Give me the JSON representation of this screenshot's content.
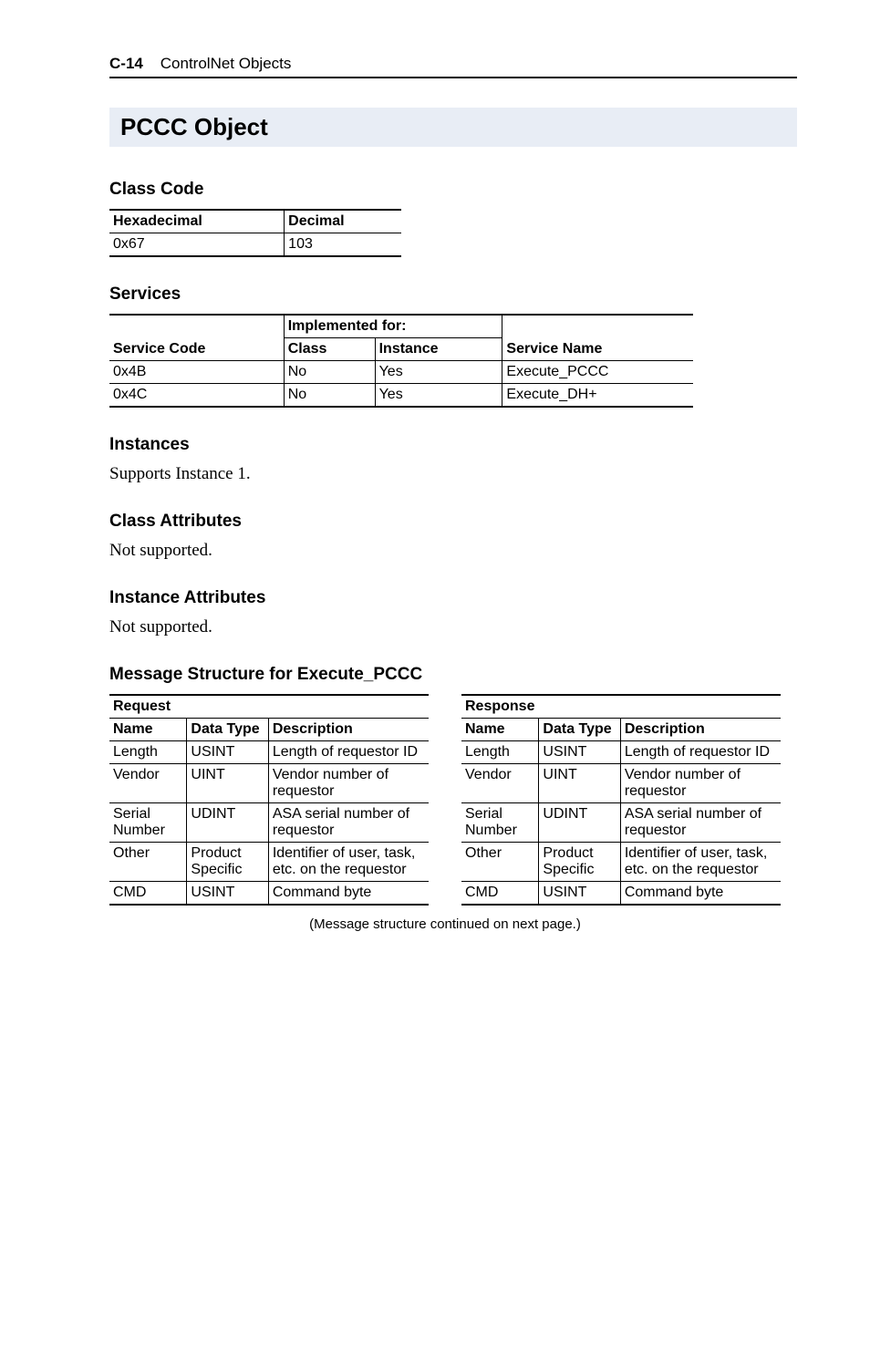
{
  "header": {
    "pagenum": "C-14",
    "chapter": "ControlNet Objects"
  },
  "title": "PCCC Object",
  "classcode": {
    "heading": "Class Code",
    "cols": {
      "hex": "Hexadecimal",
      "dec": "Decimal"
    },
    "row": {
      "hex": "0x67",
      "dec": "103"
    }
  },
  "services": {
    "heading": "Services",
    "implfor": "Implemented for:",
    "cols": {
      "code": "Service Code",
      "cls": "Class",
      "inst": "Instance",
      "name": "Service Name"
    },
    "rows": [
      {
        "code": "0x4B",
        "cls": "No",
        "inst": "Yes",
        "name": "Execute_PCCC"
      },
      {
        "code": "0x4C",
        "cls": "No",
        "inst": "Yes",
        "name": "Execute_DH+"
      }
    ]
  },
  "instances": {
    "heading": "Instances",
    "body": "Supports Instance 1."
  },
  "classattrs": {
    "heading": "Class Attributes",
    "body": "Not supported."
  },
  "instattrs": {
    "heading": "Instance Attributes",
    "body": "Not supported."
  },
  "msgstruct": {
    "heading": "Message Structure for Execute_PCCC",
    "request_label": "Request",
    "response_label": "Response",
    "cols": {
      "name": "Name",
      "type": "Data Type",
      "desc": "Description"
    },
    "rows": [
      {
        "name": "Length",
        "type": "USINT",
        "desc": "Length of requestor ID"
      },
      {
        "name": "Vendor",
        "type": "UINT",
        "desc": "Vendor number of requestor"
      },
      {
        "name": "Serial Number",
        "type": "UDINT",
        "desc": "ASA serial number of requestor"
      },
      {
        "name": "Other",
        "type": "Product Specific",
        "desc": "Identifier of user, task, etc. on the requestor"
      },
      {
        "name": "CMD",
        "type": "USINT",
        "desc": "Command byte"
      }
    ],
    "footnote": "(Message structure continued on next page.)"
  }
}
